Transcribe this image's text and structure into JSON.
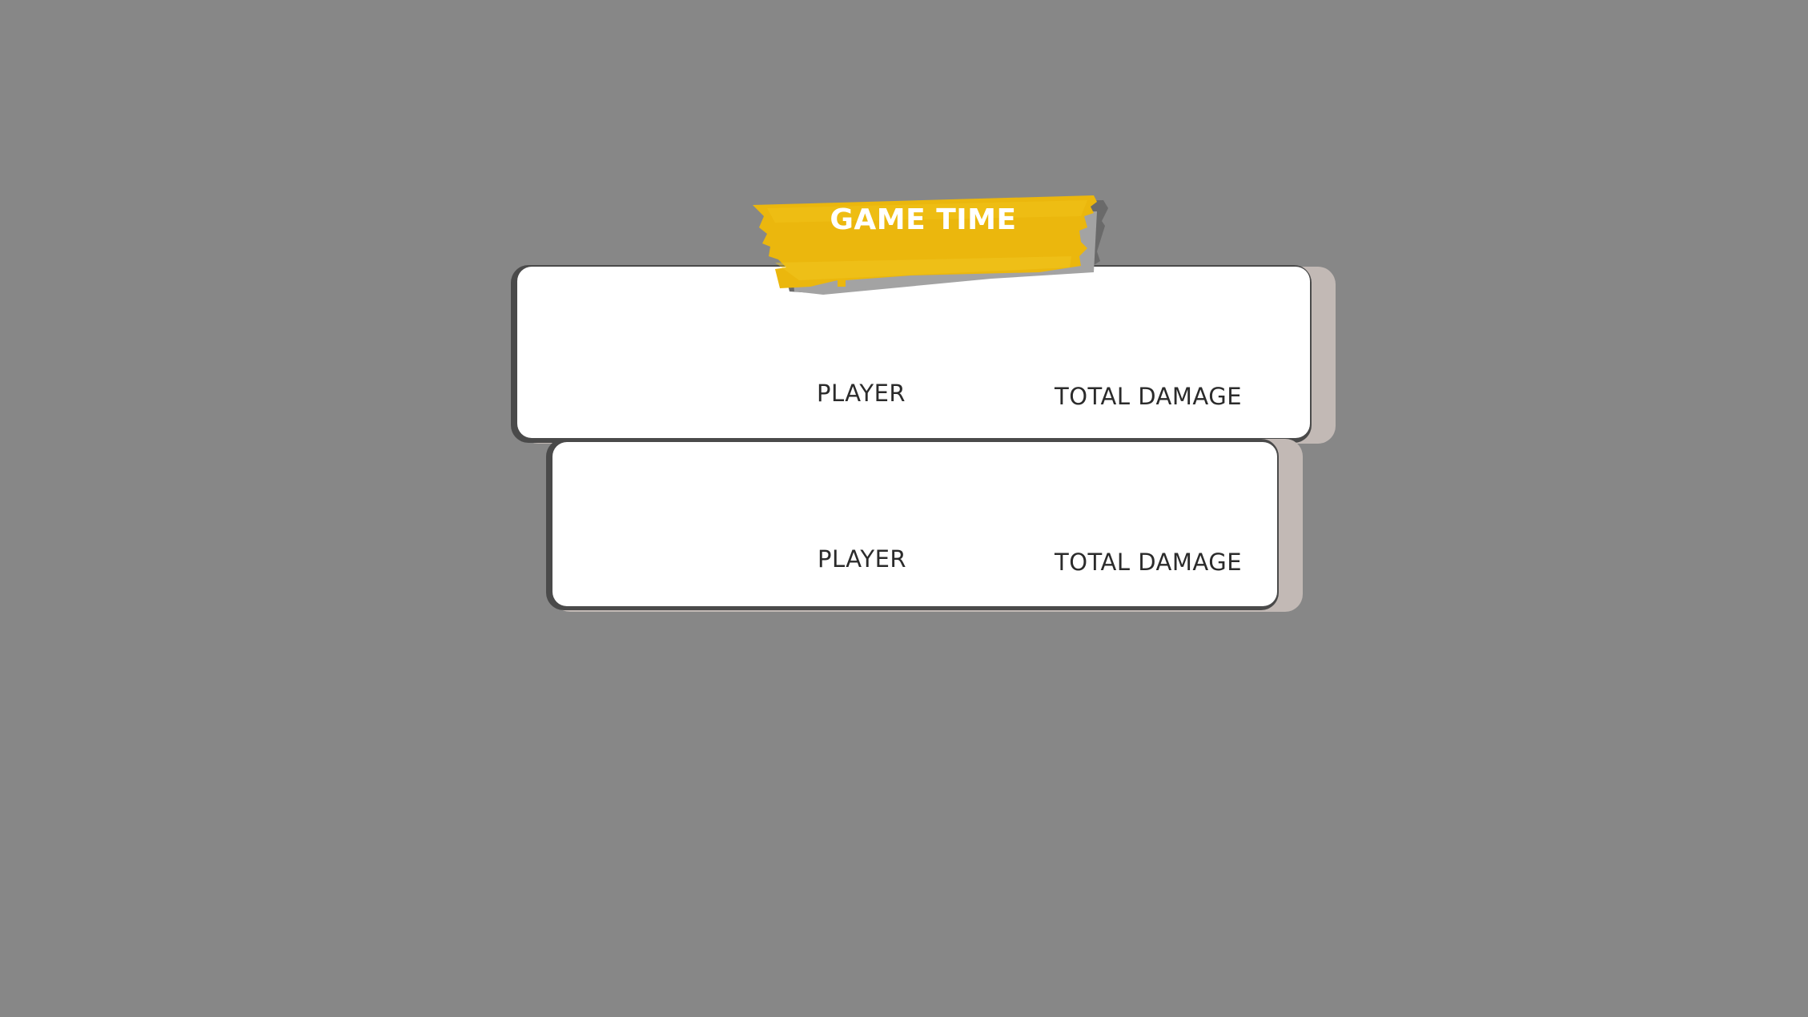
{
  "banner": {
    "title": "GAME TIME",
    "color": "#ebb70d"
  },
  "teams": [
    {
      "columns": {
        "player": "PLAYER",
        "total_damage": "TOTAL DAMAGE"
      }
    },
    {
      "columns": {
        "player": "PLAYER",
        "total_damage": "TOTAL DAMAGE"
      }
    }
  ],
  "colors": {
    "background": "#878787",
    "card": "#ffffff",
    "card_shadow": "#c2b9b5"
  }
}
